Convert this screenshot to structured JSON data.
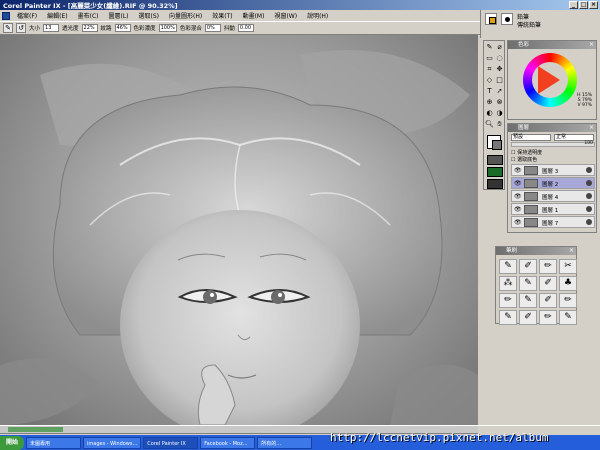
{
  "window": {
    "title": "Corel Painter IX - [高麗菜少女(纖維).RIF @ 90.32%]",
    "minimize": "_",
    "maximize": "□",
    "close": "×"
  },
  "menubar": {
    "items": [
      "檔案(F)",
      "編輯(E)",
      "畫布(C)",
      "圖層(L)",
      "選取(S)",
      "向量圖形(H)",
      "效果(T)",
      "動畫(M)",
      "視窗(W)",
      "說明(H)"
    ]
  },
  "propbar": {
    "size_label": "大小",
    "size_value": "13",
    "opacity_label": "透光度",
    "opacity_value": "22%",
    "grain_label": "紋路",
    "grain_value": "46%",
    "resat_label": "色彩濃度",
    "resat_value": "100%",
    "bleed_label": "色彩混合",
    "bleed_value": "0%",
    "jitter_label": "抖動",
    "jitter_value": "0.00"
  },
  "brush": {
    "category": "鉛筆",
    "variant": "傳統鉛筆"
  },
  "panels": {
    "color_title": "色彩",
    "color_readout": [
      "H 15%",
      "S 79%",
      "V 97%"
    ],
    "layers_title": "圖層",
    "layers_composite": "預設",
    "layers_blend": "正常",
    "layers_opacity": "100",
    "layers_check1": "保持透明度",
    "layers_check2": "選取底色",
    "layers": [
      {
        "name": "圖層 3",
        "selected": false
      },
      {
        "name": "圖層 2",
        "selected": true
      },
      {
        "name": "圖層 4",
        "selected": false
      },
      {
        "name": "圖層 1",
        "selected": false
      },
      {
        "name": "圖層 7",
        "selected": false
      }
    ],
    "brushes_title": "筆刷"
  },
  "taskbar": {
    "start": "開始",
    "buttons": [
      "未圖專用",
      "images - Windows...",
      "Corel Painter IX",
      "Facebook - Moz...",
      "所有的..."
    ]
  },
  "watermark": "http://lccnetvip.pixnet.net/album"
}
